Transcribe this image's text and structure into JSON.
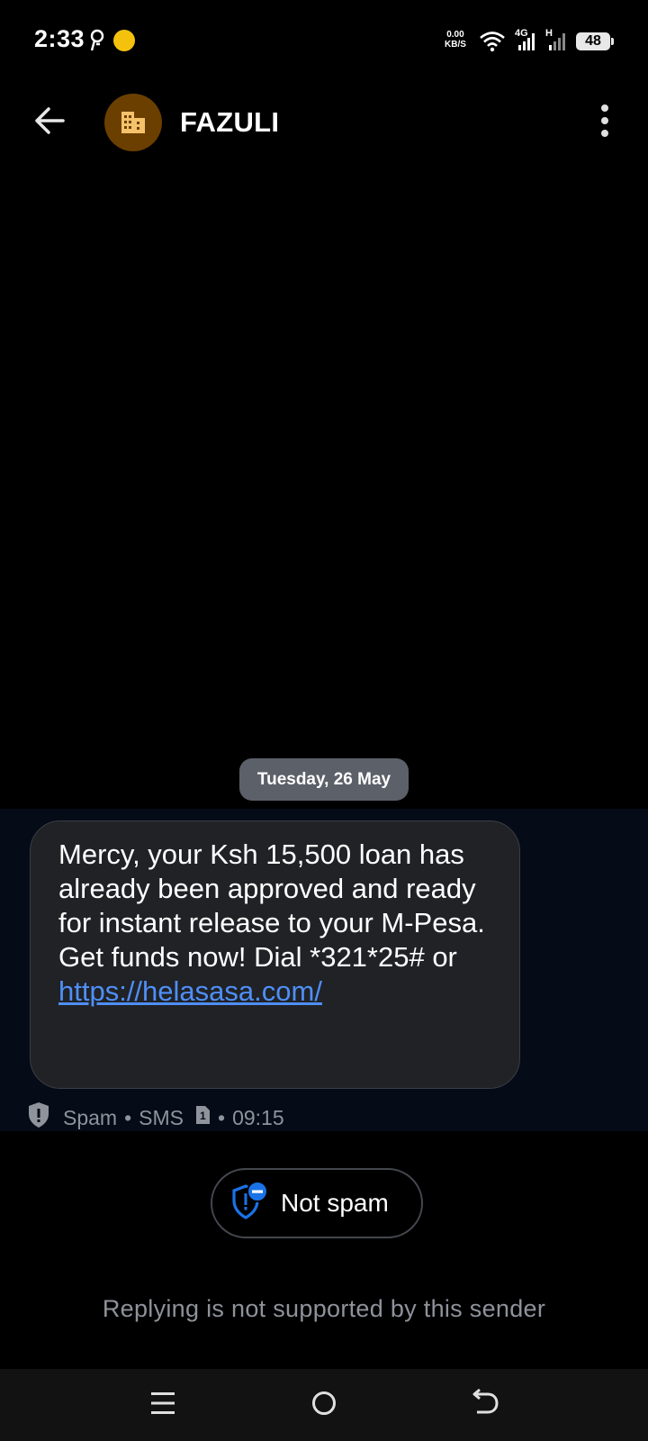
{
  "status_bar": {
    "time": "2:33",
    "net_speed_value": "0.00",
    "net_speed_unit": "KB/S",
    "network_1": "4G",
    "network_2": "H",
    "battery": "48"
  },
  "app_bar": {
    "contact_name": "FAZULI",
    "avatar_icon": "building-icon",
    "avatar_color": "#6b3f00"
  },
  "conversation": {
    "date_chip": "Tuesday, 26 May",
    "message": {
      "text": "Mercy, your Ksh 15,500 loan has already been approved and ready for instant release to your M-Pesa. Get funds now! Dial *321*25# or",
      "link": "https://helasasa.com/",
      "label": "Spam",
      "type": "SMS",
      "sim": "1",
      "time": "09:15",
      "separator": "•"
    }
  },
  "actions": {
    "not_spam_label": "Not spam"
  },
  "footer": {
    "reply_note": "Replying is not supported by this sender"
  },
  "colors": {
    "link": "#4f8ff7",
    "bubble": "#202226",
    "highlight_band": "#050b17",
    "date_chip": "#5b6069",
    "shield_accent": "#1a73e8"
  }
}
